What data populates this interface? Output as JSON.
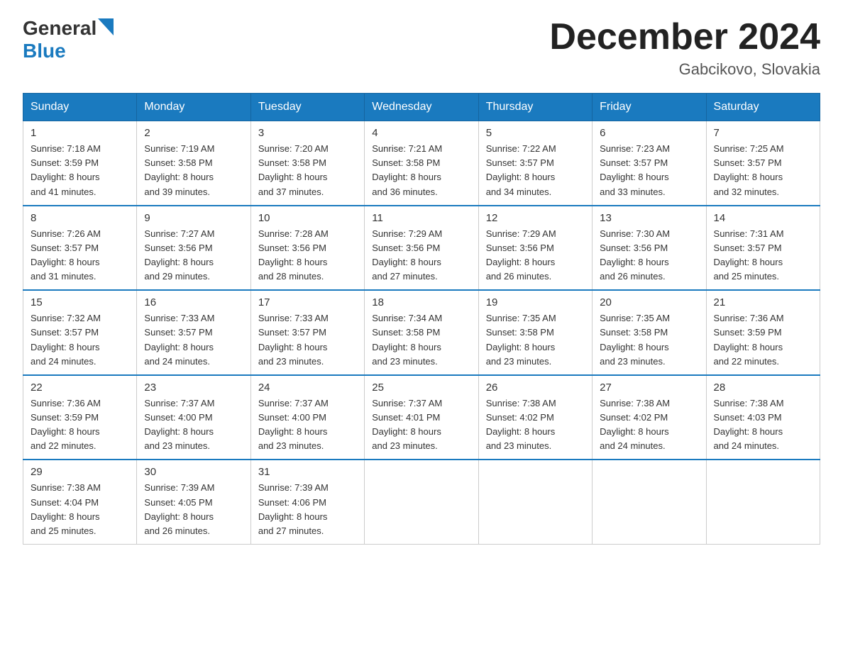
{
  "header": {
    "logo_general": "General",
    "logo_blue": "Blue",
    "month_title": "December 2024",
    "location": "Gabcikovo, Slovakia"
  },
  "weekdays": [
    "Sunday",
    "Monday",
    "Tuesday",
    "Wednesday",
    "Thursday",
    "Friday",
    "Saturday"
  ],
  "weeks": [
    [
      {
        "day": "1",
        "sunrise": "7:18 AM",
        "sunset": "3:59 PM",
        "daylight": "8 hours and 41 minutes."
      },
      {
        "day": "2",
        "sunrise": "7:19 AM",
        "sunset": "3:58 PM",
        "daylight": "8 hours and 39 minutes."
      },
      {
        "day": "3",
        "sunrise": "7:20 AM",
        "sunset": "3:58 PM",
        "daylight": "8 hours and 37 minutes."
      },
      {
        "day": "4",
        "sunrise": "7:21 AM",
        "sunset": "3:58 PM",
        "daylight": "8 hours and 36 minutes."
      },
      {
        "day": "5",
        "sunrise": "7:22 AM",
        "sunset": "3:57 PM",
        "daylight": "8 hours and 34 minutes."
      },
      {
        "day": "6",
        "sunrise": "7:23 AM",
        "sunset": "3:57 PM",
        "daylight": "8 hours and 33 minutes."
      },
      {
        "day": "7",
        "sunrise": "7:25 AM",
        "sunset": "3:57 PM",
        "daylight": "8 hours and 32 minutes."
      }
    ],
    [
      {
        "day": "8",
        "sunrise": "7:26 AM",
        "sunset": "3:57 PM",
        "daylight": "8 hours and 31 minutes."
      },
      {
        "day": "9",
        "sunrise": "7:27 AM",
        "sunset": "3:56 PM",
        "daylight": "8 hours and 29 minutes."
      },
      {
        "day": "10",
        "sunrise": "7:28 AM",
        "sunset": "3:56 PM",
        "daylight": "8 hours and 28 minutes."
      },
      {
        "day": "11",
        "sunrise": "7:29 AM",
        "sunset": "3:56 PM",
        "daylight": "8 hours and 27 minutes."
      },
      {
        "day": "12",
        "sunrise": "7:29 AM",
        "sunset": "3:56 PM",
        "daylight": "8 hours and 26 minutes."
      },
      {
        "day": "13",
        "sunrise": "7:30 AM",
        "sunset": "3:56 PM",
        "daylight": "8 hours and 26 minutes."
      },
      {
        "day": "14",
        "sunrise": "7:31 AM",
        "sunset": "3:57 PM",
        "daylight": "8 hours and 25 minutes."
      }
    ],
    [
      {
        "day": "15",
        "sunrise": "7:32 AM",
        "sunset": "3:57 PM",
        "daylight": "8 hours and 24 minutes."
      },
      {
        "day": "16",
        "sunrise": "7:33 AM",
        "sunset": "3:57 PM",
        "daylight": "8 hours and 24 minutes."
      },
      {
        "day": "17",
        "sunrise": "7:33 AM",
        "sunset": "3:57 PM",
        "daylight": "8 hours and 23 minutes."
      },
      {
        "day": "18",
        "sunrise": "7:34 AM",
        "sunset": "3:58 PM",
        "daylight": "8 hours and 23 minutes."
      },
      {
        "day": "19",
        "sunrise": "7:35 AM",
        "sunset": "3:58 PM",
        "daylight": "8 hours and 23 minutes."
      },
      {
        "day": "20",
        "sunrise": "7:35 AM",
        "sunset": "3:58 PM",
        "daylight": "8 hours and 23 minutes."
      },
      {
        "day": "21",
        "sunrise": "7:36 AM",
        "sunset": "3:59 PM",
        "daylight": "8 hours and 22 minutes."
      }
    ],
    [
      {
        "day": "22",
        "sunrise": "7:36 AM",
        "sunset": "3:59 PM",
        "daylight": "8 hours and 22 minutes."
      },
      {
        "day": "23",
        "sunrise": "7:37 AM",
        "sunset": "4:00 PM",
        "daylight": "8 hours and 23 minutes."
      },
      {
        "day": "24",
        "sunrise": "7:37 AM",
        "sunset": "4:00 PM",
        "daylight": "8 hours and 23 minutes."
      },
      {
        "day": "25",
        "sunrise": "7:37 AM",
        "sunset": "4:01 PM",
        "daylight": "8 hours and 23 minutes."
      },
      {
        "day": "26",
        "sunrise": "7:38 AM",
        "sunset": "4:02 PM",
        "daylight": "8 hours and 23 minutes."
      },
      {
        "day": "27",
        "sunrise": "7:38 AM",
        "sunset": "4:02 PM",
        "daylight": "8 hours and 24 minutes."
      },
      {
        "day": "28",
        "sunrise": "7:38 AM",
        "sunset": "4:03 PM",
        "daylight": "8 hours and 24 minutes."
      }
    ],
    [
      {
        "day": "29",
        "sunrise": "7:38 AM",
        "sunset": "4:04 PM",
        "daylight": "8 hours and 25 minutes."
      },
      {
        "day": "30",
        "sunrise": "7:39 AM",
        "sunset": "4:05 PM",
        "daylight": "8 hours and 26 minutes."
      },
      {
        "day": "31",
        "sunrise": "7:39 AM",
        "sunset": "4:06 PM",
        "daylight": "8 hours and 27 minutes."
      },
      null,
      null,
      null,
      null
    ]
  ],
  "labels": {
    "sunrise": "Sunrise: ",
    "sunset": "Sunset: ",
    "daylight": "Daylight: "
  }
}
